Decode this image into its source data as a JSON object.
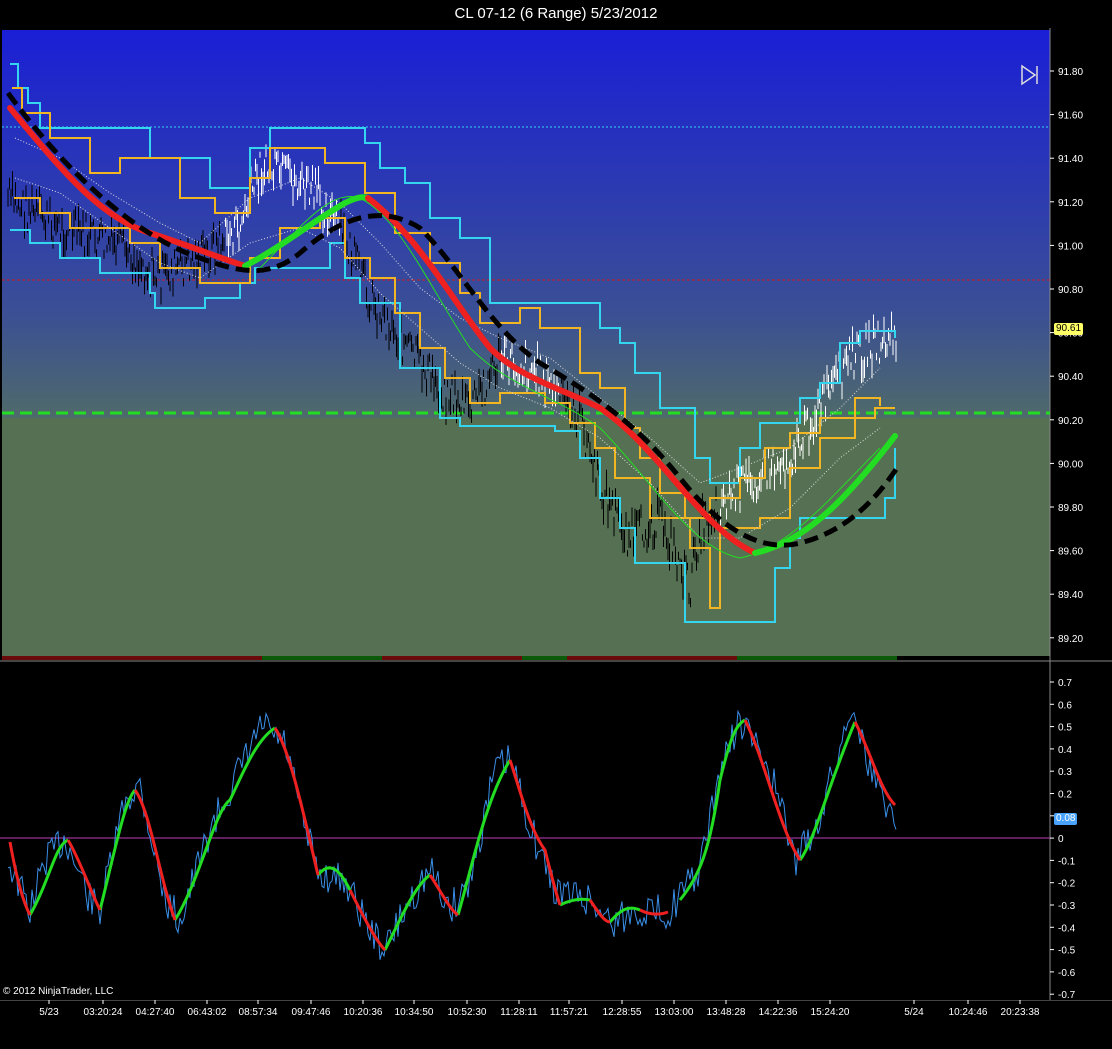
{
  "window": {
    "title": "CL 07-12 (6 Range)  5/23/2012"
  },
  "price_axis": {
    "ticks": [
      "91.80",
      "91.60",
      "91.40",
      "91.20",
      "91.00",
      "90.80",
      "90.60",
      "90.40",
      "90.20",
      "90.00",
      "89.80",
      "89.60",
      "89.40",
      "89.20"
    ]
  },
  "price_tag": {
    "label": "90.61",
    "color": "#ffff66"
  },
  "osc_axis": {
    "ticks": [
      "0.7",
      "0.6",
      "0.5",
      "0.4",
      "0.3",
      "0.2",
      "0.1",
      "0",
      "-0.1",
      "-0.2",
      "-0.3",
      "-0.4",
      "-0.5",
      "-0.6",
      "-0.7"
    ]
  },
  "osc_tag": {
    "label": "0.08",
    "color": "#4aa3ff"
  },
  "time_axis": {
    "ticks": [
      "5/23",
      "03:20:24",
      "04:27:40",
      "06:43:02",
      "08:57:34",
      "09:47:46",
      "10:20:36",
      "10:34:50",
      "10:52:30",
      "11:28:11",
      "11:57:21",
      "12:28:55",
      "13:03:00",
      "13:48:28",
      "14:22:36",
      "15:24:20",
      "5/24",
      "10:24:46",
      "20:23:38"
    ]
  },
  "footer": {
    "copyright": "© 2012 NinjaTrader, LLC"
  },
  "controls": {
    "play_icon": "skip-to-end-icon"
  },
  "colors": {
    "background_top": "#1a22cc",
    "background_bottom": "#557052",
    "channel_outer": "#33d6ee",
    "channel_inner": "#f2b623",
    "trend_up": "#22dd22",
    "trend_down": "#ee2020",
    "baseline_dash": "#000000",
    "hline_green": "#22dd22",
    "hline_red": "#cc2020",
    "osc_raw": "#3a8fe8"
  }
}
